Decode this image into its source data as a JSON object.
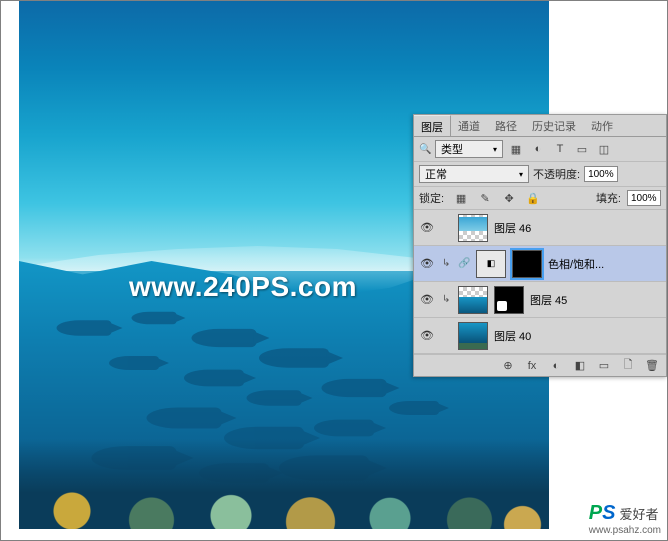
{
  "watermarks": {
    "center": "www.240PS.com",
    "corner_label": "爱好者",
    "corner_url": "www.psahz.com"
  },
  "panel": {
    "tabs": [
      "图层",
      "通道",
      "路径",
      "历史记录",
      "动作"
    ],
    "active_tab": 0,
    "filter_label": "类型",
    "type_icons": [
      "▦",
      "◐",
      "T",
      "▭",
      "◫"
    ],
    "blend_mode": "正常",
    "opacity_label": "不透明度:",
    "opacity_value": "100%",
    "lock_label": "锁定:",
    "lock_icons": [
      "▦",
      "✎",
      "✥",
      "🔒"
    ],
    "fill_label": "填充:",
    "fill_value": "100%",
    "footer_icons": [
      "⊕",
      "fx",
      "◐",
      "◧",
      "▭",
      "🗋",
      "🗑"
    ]
  },
  "layers": [
    {
      "name": "图层 46",
      "visible": true,
      "selected": false,
      "clipped": false,
      "thumb": "sky-checker",
      "mask": null
    },
    {
      "name": "色相/饱和...",
      "visible": true,
      "selected": true,
      "clipped": true,
      "thumb": "adj",
      "mask": "black"
    },
    {
      "name": "图层 45",
      "visible": true,
      "selected": false,
      "clipped": true,
      "thumb": "under-checker",
      "mask": "white-blob"
    },
    {
      "name": "图层 40",
      "visible": true,
      "selected": false,
      "clipped": false,
      "thumb": "under",
      "mask": null
    }
  ]
}
